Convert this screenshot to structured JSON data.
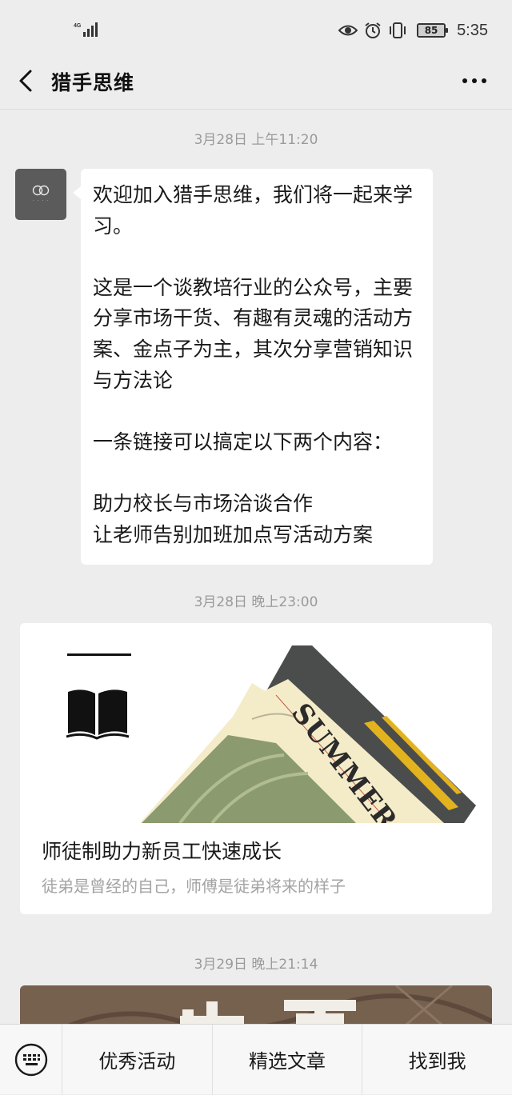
{
  "status_bar": {
    "network": "4G",
    "battery_level": "85",
    "time": "5:35",
    "icons": [
      "eye-icon",
      "alarm-icon",
      "vibrate-icon",
      "battery-icon"
    ]
  },
  "nav": {
    "title": "猎手思维"
  },
  "messages": [
    {
      "timestamp": "3月28日 上午11:20",
      "text": "欢迎加入猎手思维，我们将一起来学习。\n\n这是一个谈教培行业的公众号，主要分享市场干货、有趣有灵魂的活动方案、金点子为主，其次分享营销知识与方法论\n\n一条链接可以搞定以下两个内容：\n\n助力校长与市场洽谈合作\n让老师告别加班加点写活动方案"
    },
    {
      "timestamp": "3月28日 晚上23:00",
      "article_title": "师徒制助力新员工快速成长",
      "article_digest": "徒弟是曾经的自己，师傅是徒弟将来的样子",
      "cover_text": "SUMMER"
    },
    {
      "timestamp": "3月29日 晚上21:14"
    }
  ],
  "bottom_menu": {
    "items": [
      "优秀活动",
      "精选文章",
      "找到我"
    ]
  }
}
